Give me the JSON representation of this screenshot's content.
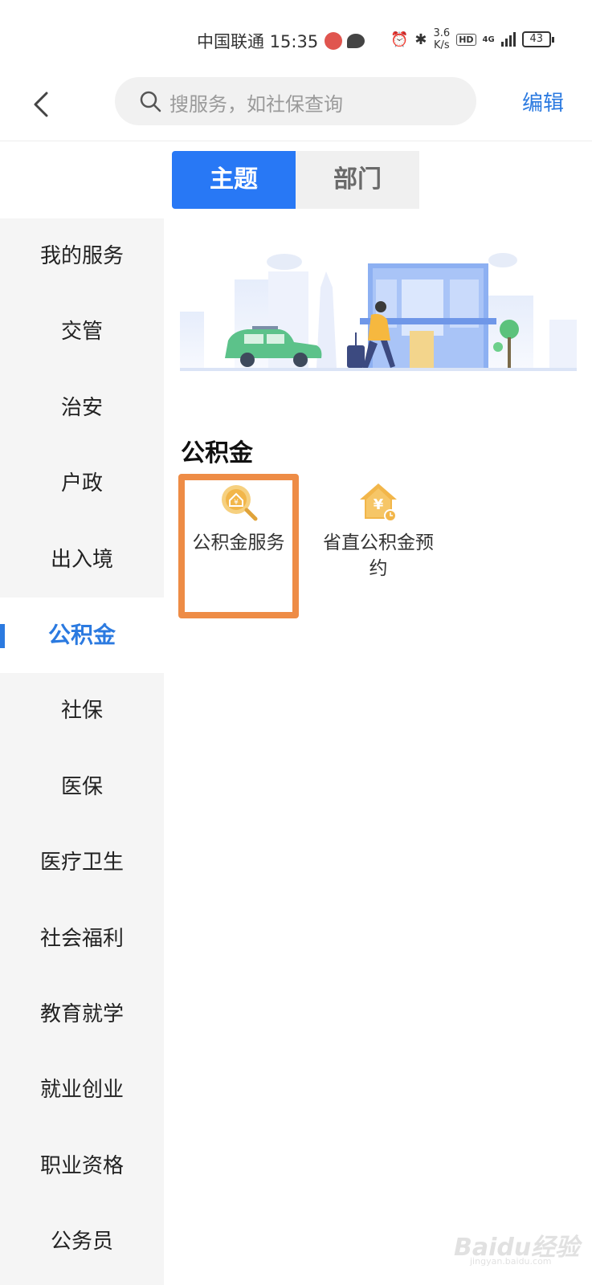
{
  "status_bar": {
    "carrier_time": "中国联通 15:35",
    "speed_value": "3.6",
    "speed_unit": "K/s",
    "hd": "HD",
    "network": "4G",
    "battery": "43"
  },
  "header": {
    "search_placeholder": "搜服务，如社保查询",
    "edit_label": "编辑"
  },
  "tabs": {
    "topic": "主题",
    "department": "部门"
  },
  "sidebar": {
    "items": [
      {
        "label": "我的服务"
      },
      {
        "label": "交管"
      },
      {
        "label": "治安"
      },
      {
        "label": "户政"
      },
      {
        "label": "出入境"
      },
      {
        "label": "公积金"
      },
      {
        "label": "社保"
      },
      {
        "label": "医保"
      },
      {
        "label": "医疗卫生"
      },
      {
        "label": "社会福利"
      },
      {
        "label": "教育就学"
      },
      {
        "label": "就业创业"
      },
      {
        "label": "职业资格"
      },
      {
        "label": "公务员"
      }
    ],
    "active_index": 5
  },
  "section": {
    "title": "公积金",
    "services": [
      {
        "label": "公积金服务",
        "icon": "fund-search-icon"
      },
      {
        "label": "省直公积金预约",
        "icon": "fund-house-appointment-icon"
      }
    ]
  },
  "watermark": {
    "brand": "Baidu经验",
    "site": "jingyan.baidu.com"
  },
  "colors": {
    "accent": "#2878f5",
    "link": "#2b7ae0",
    "highlight_box": "#ee8c46",
    "icon_gold": "#f2b64a"
  }
}
